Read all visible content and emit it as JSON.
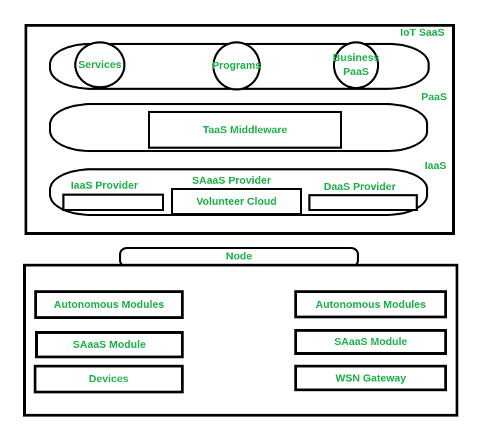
{
  "diagram": {
    "accent_color": "#1fb14a",
    "top_layer": {
      "iot_saas": {
        "label": "IoT SaaS",
        "items": [
          {
            "label": "Services"
          },
          {
            "label": "Programs"
          },
          {
            "label": "Business PaaS",
            "line1": "Business",
            "line2": "PaaS"
          }
        ]
      },
      "paas": {
        "label": "PaaS",
        "middleware": "TaaS Middleware"
      },
      "iaas": {
        "label": "IaaS",
        "providers": [
          {
            "label": "IaaS Provider",
            "content": ""
          },
          {
            "label": "SAaaS Provider",
            "content": "Volunteer Cloud"
          },
          {
            "label": "DaaS Provider",
            "content": ""
          }
        ]
      }
    },
    "node": {
      "label": "Node",
      "left_modules": [
        "Autonomous Modules",
        "SAaaS Module",
        "Devices"
      ],
      "right_modules": [
        "Autonomous Modules",
        "SAaaS Module",
        "WSN Gateway"
      ]
    }
  }
}
